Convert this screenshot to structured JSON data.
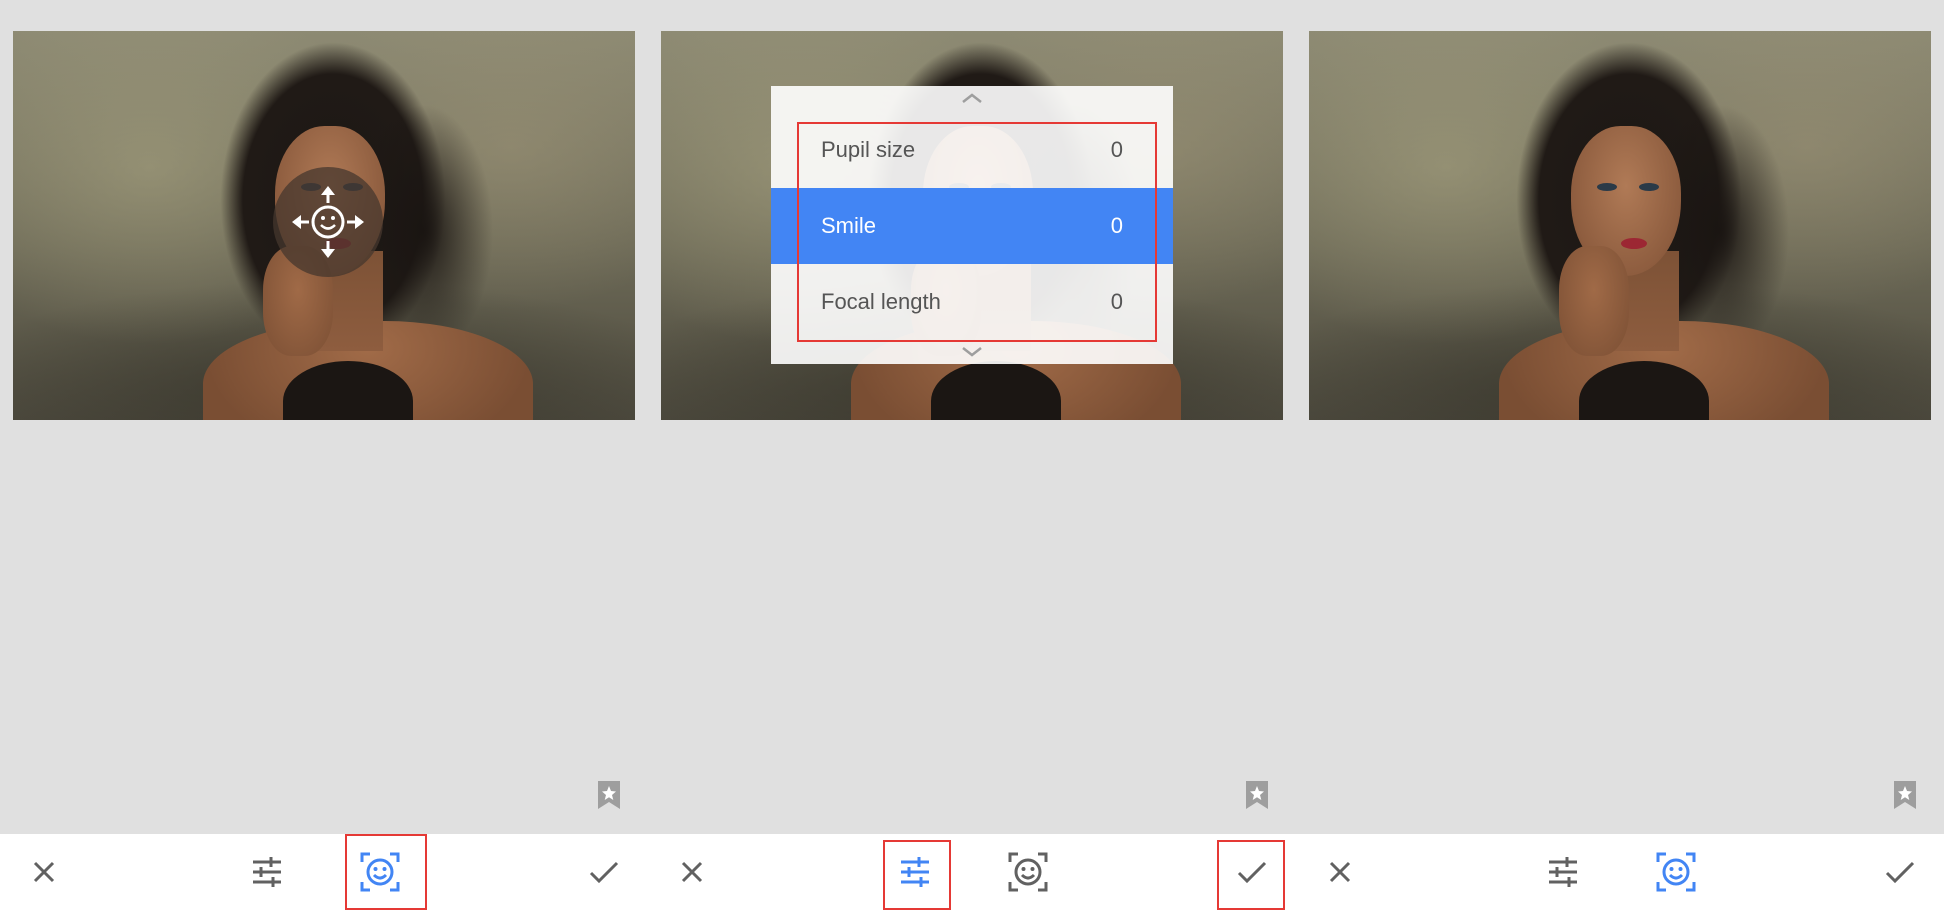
{
  "panels": [
    {
      "id": "face-select",
      "handle_icons": [
        "smiley-face-icon",
        "arrow-up-icon",
        "arrow-down-icon",
        "arrow-left-icon",
        "arrow-right-icon"
      ],
      "toolbar": {
        "active": "face-icon",
        "highlighted": "face-icon"
      }
    },
    {
      "id": "adjustment-menu",
      "menu": {
        "items": [
          {
            "label": "Pupil size",
            "value": "0"
          },
          {
            "label": "Smile",
            "value": "0",
            "selected": true
          },
          {
            "label": "Focal length",
            "value": "0"
          }
        ]
      },
      "toolbar": {
        "active": "sliders-icon",
        "highlighted": [
          "sliders-icon",
          "checkmark-icon"
        ]
      }
    },
    {
      "id": "result",
      "toolbar": {
        "active": "face-icon"
      }
    }
  ],
  "toolbar_icons": [
    "close-icon",
    "sliders-icon",
    "face-icon",
    "checkmark-icon"
  ],
  "colors": {
    "background": "#e0e0e0",
    "accent": "#4285f4",
    "icon_default": "#616161",
    "highlight_box": "#e53935",
    "bar": "#ffffff"
  }
}
